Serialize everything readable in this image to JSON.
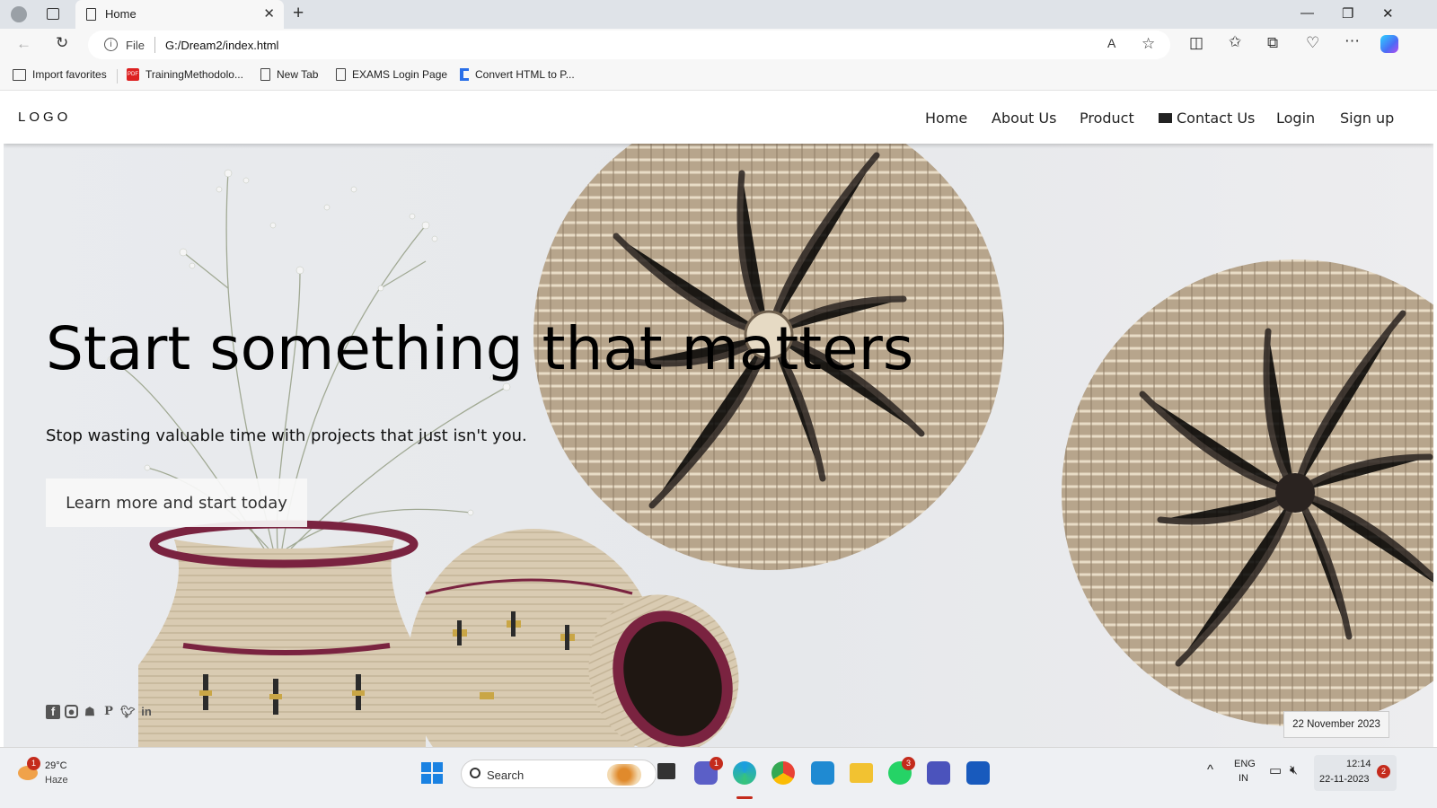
{
  "browser": {
    "tab_title": "Home",
    "new_tab_glyph": "+",
    "close_glyph": "✕",
    "address": {
      "scheme_label": "File",
      "url": "G:/Dream2/index.html"
    },
    "favorites": [
      {
        "label": "Import favorites",
        "icon": "import-icon"
      },
      {
        "label": "TrainingMethodolo...",
        "icon": "pdf-icon"
      },
      {
        "label": "New Tab",
        "icon": "page-icon"
      },
      {
        "label": "EXAMS Login Page",
        "icon": "page-icon"
      },
      {
        "label": "Convert HTML to P...",
        "icon": "converter-icon"
      }
    ]
  },
  "site": {
    "logo": "LOGO",
    "nav": {
      "home": "Home",
      "about": "About Us",
      "product": "Product",
      "contact": "Contact Us",
      "login": "Login",
      "signup": "Sign up"
    },
    "hero": {
      "headline": "Start something that matters",
      "subline": "Stop wasting valuable time with projects that just isn't you.",
      "cta": "Learn more and start today"
    },
    "social": [
      "facebook-icon",
      "instagram-icon",
      "snapchat-icon",
      "pinterest-icon",
      "twitter-icon",
      "linkedin-icon"
    ],
    "date": "22 November 2023"
  },
  "taskbar": {
    "weather": {
      "temp": "29°C",
      "condition": "Haze",
      "badge": "1"
    },
    "search_label": "Search",
    "badges": {
      "teams_chat": "1",
      "whatsapp": "3",
      "notifications": "2"
    },
    "tray": {
      "lang_top": "ENG",
      "lang_bottom": "IN",
      "time": "12:14",
      "date": "22-11-2023"
    }
  },
  "colors": {
    "nav_bg": "#ffffff",
    "hero_bg": "#e9ebee",
    "cta_bg": "#f8f8f8",
    "basket_dark": "#2a2320",
    "basket_light": "#d9cbb2",
    "vase_rim": "#7a2340"
  }
}
